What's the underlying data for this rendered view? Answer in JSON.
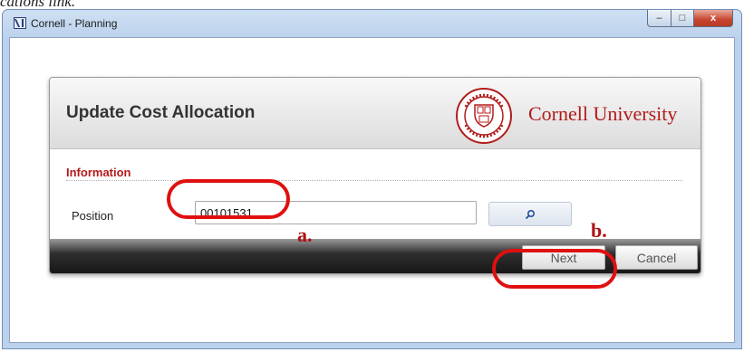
{
  "caption": "cations link.",
  "window": {
    "title": "Cornell - Planning",
    "controls": {
      "minimize": "–",
      "maximize": "□",
      "close": "x"
    }
  },
  "dialog": {
    "title": "Update Cost Allocation",
    "brand": "Cornell University",
    "section": "Information",
    "field_label": "Position",
    "position_value": "00101531",
    "search_icon": "magnifier-icon",
    "next_label": "Next",
    "cancel_label": "Cancel"
  },
  "annotations": {
    "a": "a.",
    "b": "b."
  },
  "colors": {
    "cornell_red": "#b31b1b",
    "annotation_red": "#e01010"
  }
}
